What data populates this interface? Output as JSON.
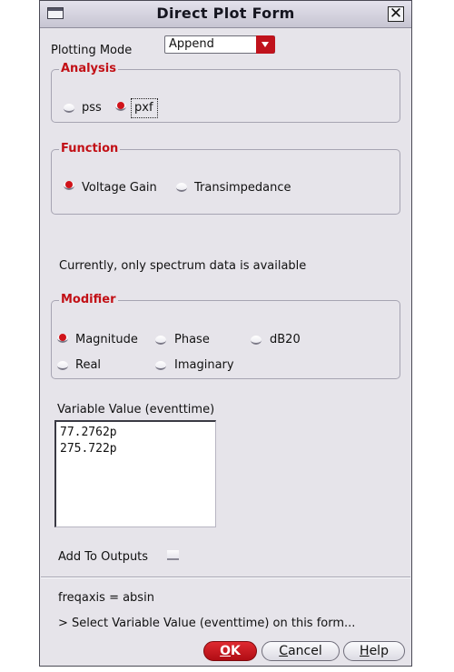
{
  "window": {
    "title": "Direct Plot Form"
  },
  "plotting_mode": {
    "label": "Plotting Mode",
    "value": "Append"
  },
  "analysis": {
    "legend": "Analysis",
    "options": [
      {
        "label": "pss",
        "selected": false
      },
      {
        "label": "pxf",
        "selected": true
      }
    ]
  },
  "function": {
    "legend": "Function",
    "options": [
      {
        "label": "Voltage Gain",
        "selected": true
      },
      {
        "label": "Transimpedance",
        "selected": false
      }
    ]
  },
  "info_text": "Currently, only spectrum data is available",
  "modifier": {
    "legend": "Modifier",
    "options": [
      {
        "label": "Magnitude",
        "selected": true
      },
      {
        "label": "Phase",
        "selected": false
      },
      {
        "label": "dB20",
        "selected": false
      },
      {
        "label": "Real",
        "selected": false
      },
      {
        "label": "Imaginary",
        "selected": false
      }
    ]
  },
  "variable_value": {
    "label": "Variable Value (eventtime)",
    "items": [
      "77.2762p",
      "275.722p"
    ]
  },
  "add_to_outputs": {
    "label": "Add To Outputs",
    "checked": false
  },
  "status": {
    "freqaxis": "freqaxis = absin",
    "prompt": "> Select Variable Value (eventtime) on this form..."
  },
  "buttons": {
    "ok": {
      "mnemonic": "O",
      "rest": "K"
    },
    "cancel": {
      "mnemonic": "C",
      "rest": "ancel"
    },
    "help": {
      "mnemonic": "H",
      "rest": "elp"
    }
  },
  "colors": {
    "accent_red": "#c21016",
    "window_bg": "#e6e4ea"
  }
}
